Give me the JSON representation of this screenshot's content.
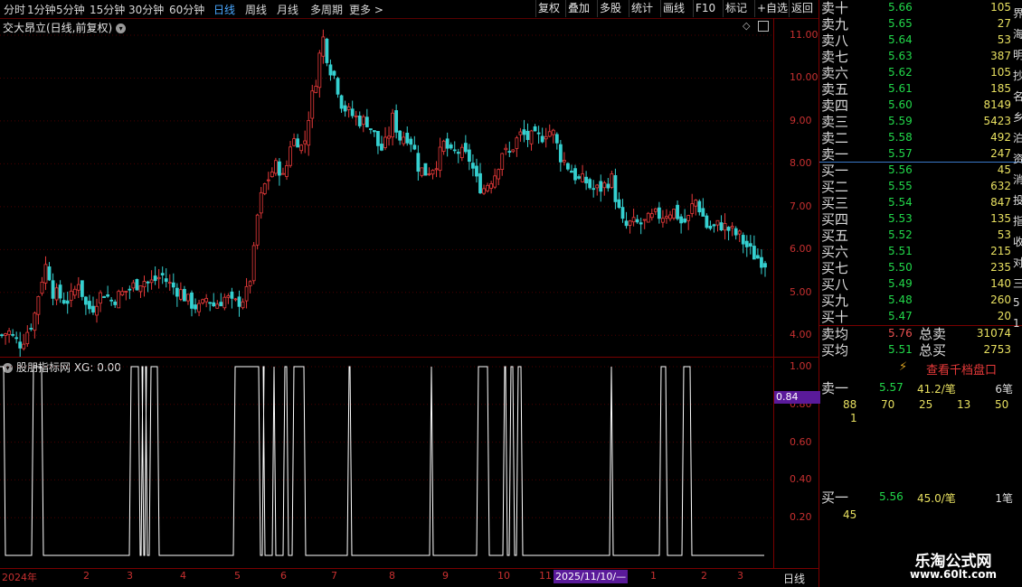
{
  "toolbar": {
    "periods": [
      "分时",
      "1分钟",
      "5分钟",
      "15分钟",
      "30分钟",
      "60分钟",
      "日线",
      "周线",
      "月线",
      "多周期",
      "更多 >"
    ],
    "active_period": "日线",
    "buttons": [
      "复权",
      "叠加",
      "多股",
      "统计",
      "画线",
      "F10",
      "标记",
      "+自选",
      "返回"
    ]
  },
  "chart": {
    "title": "交大昂立(日线,前复权)",
    "price_labels": [
      "11.00",
      "10.00",
      "9.00",
      "8.00",
      "7.00",
      "6.00",
      "5.00",
      "4.00"
    ],
    "indicator_title": "股朋指标网 XG: 0.00",
    "indicator_labels": [
      "1.00",
      "0.80",
      "0.60",
      "0.40",
      "0.20"
    ],
    "indicator_current": "0.84",
    "date_labels": [
      "2024年",
      "2",
      "3",
      "4",
      "5",
      "6",
      "7",
      "8",
      "9",
      "10",
      "11",
      "1",
      "2",
      "3"
    ],
    "date_highlight": "2025/11/10/—",
    "period_label": "日线",
    "colors": {
      "up": "#e83a3a",
      "down": "#35d0d0",
      "axis": "#c83030",
      "highlight": "#5a1a9a"
    }
  },
  "chart_data": {
    "type": "candlestick",
    "ylim": [
      3.5,
      11.4
    ],
    "close_samples": [
      4.0,
      4.1,
      3.9,
      3.8,
      4.1,
      4.4,
      5.2,
      5.7,
      5.0,
      4.9,
      4.8,
      4.9,
      5.3,
      4.7,
      4.6,
      4.9,
      5.0,
      4.8,
      4.9,
      5.0,
      5.1,
      5.2,
      5.3,
      5.2,
      5.3,
      5.4,
      5.2,
      5.1,
      5.0,
      4.8,
      4.7,
      4.6,
      4.9,
      4.7,
      4.8,
      4.9,
      4.7,
      4.8,
      4.9,
      5.5,
      7.0,
      7.5,
      7.8,
      8.0,
      7.6,
      8.5,
      8.6,
      8.3,
      9.3,
      10.0,
      11.0,
      10.3,
      10.0,
      9.4,
      9.2,
      9.1,
      9.0,
      9.0,
      8.7,
      8.3,
      8.5,
      9.1,
      8.6,
      8.7,
      8.5,
      7.9,
      7.8,
      7.9,
      8.1,
      8.5,
      8.2,
      8.3,
      8.2,
      8.1,
      7.6,
      7.4,
      7.6,
      7.8,
      8.3,
      8.2,
      8.5,
      8.7,
      8.6,
      8.6,
      8.6,
      8.8,
      8.7,
      8.2,
      8.0,
      7.8,
      7.6,
      7.6,
      7.4,
      7.4,
      7.5,
      7.7,
      7.0,
      6.5,
      6.6,
      6.6,
      6.6,
      6.7,
      6.8,
      6.8,
      6.9,
      6.9,
      6.6,
      6.7,
      7.2,
      6.9,
      6.5,
      6.5,
      6.6,
      6.5,
      6.4,
      6.3,
      6.1,
      5.9,
      5.8,
      5.7
    ],
    "xg_signal_active_ranges": [
      [
        0,
        4
      ],
      [
        35,
        46
      ],
      [
        143,
        153
      ],
      [
        156,
        157
      ],
      [
        160,
        161
      ],
      [
        165,
        174
      ],
      [
        258,
        286
      ],
      [
        290,
        291
      ],
      [
        301,
        303
      ],
      [
        313,
        317
      ],
      [
        323,
        336
      ],
      [
        384,
        387
      ],
      [
        475,
        477
      ],
      [
        527,
        539
      ],
      [
        556,
        559
      ],
      [
        563,
        567
      ],
      [
        571,
        576
      ],
      [
        674,
        676
      ],
      [
        729,
        736
      ],
      [
        754,
        763
      ]
    ],
    "xg_domain": [
      0,
      845
    ]
  },
  "orderbook": {
    "asks": [
      {
        "label": "卖十",
        "price": "5.66",
        "vol": "105"
      },
      {
        "label": "卖九",
        "price": "5.65",
        "vol": "27"
      },
      {
        "label": "卖八",
        "price": "5.64",
        "vol": "53"
      },
      {
        "label": "卖七",
        "price": "5.63",
        "vol": "387"
      },
      {
        "label": "卖六",
        "price": "5.62",
        "vol": "105"
      },
      {
        "label": "卖五",
        "price": "5.61",
        "vol": "185"
      },
      {
        "label": "卖四",
        "price": "5.60",
        "vol": "8149"
      },
      {
        "label": "卖三",
        "price": "5.59",
        "vol": "5423"
      },
      {
        "label": "卖二",
        "price": "5.58",
        "vol": "492"
      },
      {
        "label": "卖一",
        "price": "5.57",
        "vol": "247"
      }
    ],
    "bids": [
      {
        "label": "买一",
        "price": "5.56",
        "vol": "45"
      },
      {
        "label": "买二",
        "price": "5.55",
        "vol": "632"
      },
      {
        "label": "买三",
        "price": "5.54",
        "vol": "847"
      },
      {
        "label": "买四",
        "price": "5.53",
        "vol": "135"
      },
      {
        "label": "买五",
        "price": "5.52",
        "vol": "53"
      },
      {
        "label": "买六",
        "price": "5.51",
        "vol": "215"
      },
      {
        "label": "买七",
        "price": "5.50",
        "vol": "235"
      },
      {
        "label": "买八",
        "price": "5.49",
        "vol": "140"
      },
      {
        "label": "买九",
        "price": "5.48",
        "vol": "260"
      },
      {
        "label": "买十",
        "price": "5.47",
        "vol": "20"
      }
    ],
    "summary": {
      "ask_avg_label": "卖均",
      "ask_avg": "5.76",
      "ask_total_label": "总卖",
      "ask_total": "31074",
      "bid_avg_label": "买均",
      "bid_avg": "5.51",
      "bid_total_label": "总买",
      "bid_total": "2753"
    },
    "edge_chars": [
      "界",
      "海",
      "明",
      "抄",
      "名",
      "乡",
      "泊",
      "资",
      "消",
      "投",
      "指",
      "收",
      "对",
      "三",
      "5",
      "1"
    ]
  },
  "level2": {
    "button_label": "查看千档盘口",
    "ask1": {
      "label": "卖一",
      "price": "5.57",
      "avg": "41.2/笔",
      "count": "6笔",
      "queue": [
        "88",
        "70",
        "25",
        "13",
        "50",
        "1"
      ]
    },
    "bid1": {
      "label": "买一",
      "price": "5.56",
      "avg": "45.0/笔",
      "count": "1笔",
      "queue": [
        "45"
      ]
    }
  },
  "watermark": {
    "title": "乐淘公式网",
    "url": "www.60lt.com"
  }
}
